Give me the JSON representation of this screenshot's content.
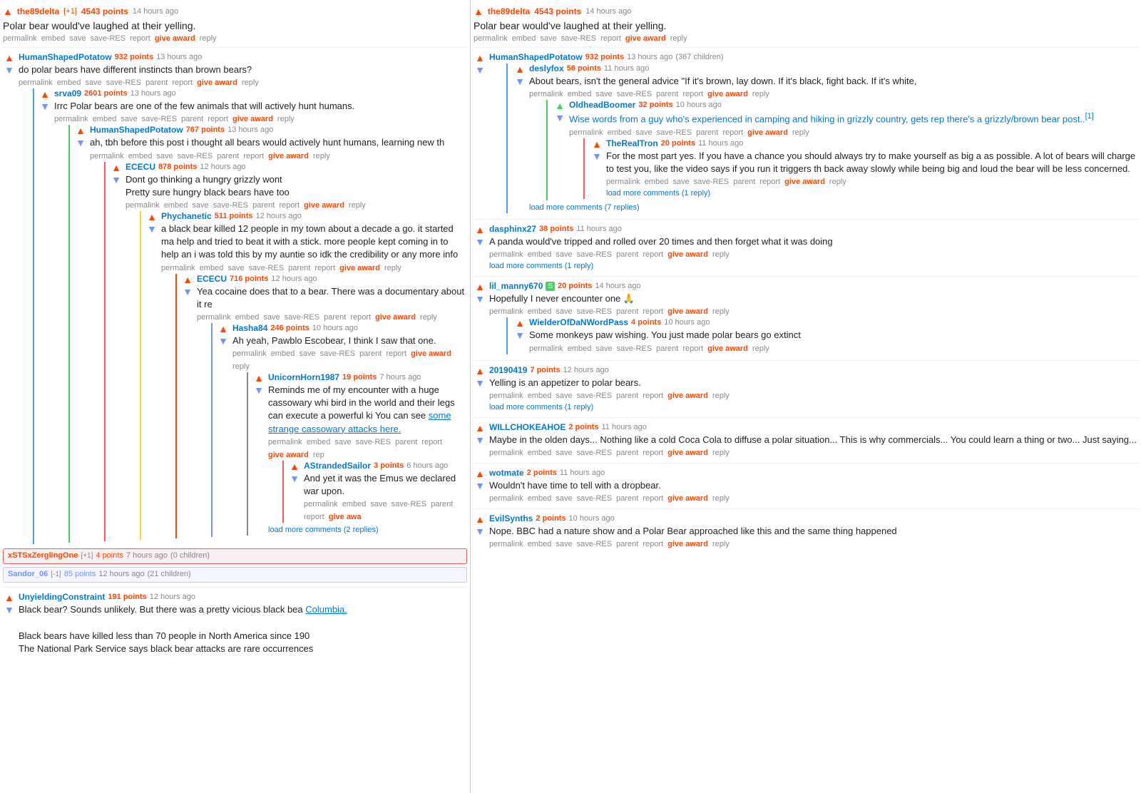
{
  "leftPanel": {
    "topComment": {
      "username": "the89delta",
      "points": "4543 points",
      "timestamp": "14 hours ago",
      "awards": "[+1]",
      "body": "Polar bear would've laughed at their yelling.",
      "actions": [
        "permalink",
        "embed",
        "save",
        "save-RES",
        "report",
        "give award",
        "reply"
      ]
    },
    "comments": [
      {
        "id": "c1",
        "username": "HumanShapedPotatow",
        "points": "932 points",
        "timestamp": "13 hours ago",
        "body": "do polar bears have different instincts than brown bears?",
        "actions": [
          "permalink",
          "embed",
          "save",
          "save-RES",
          "parent",
          "report",
          "give award",
          "reply"
        ],
        "indent": 0,
        "children": [
          {
            "id": "c1-1",
            "username": "srva09",
            "points": "2601 points",
            "timestamp": "13 hours ago",
            "body": "Irrc Polar bears are one of the few animals that will actively hunt humans.",
            "actions": [
              "permalink",
              "embed",
              "save",
              "save-RES",
              "parent",
              "report",
              "give award",
              "reply"
            ],
            "indent": 1,
            "children": [
              {
                "id": "c1-1-1",
                "username": "HumanShapedPotatow",
                "points": "767 points",
                "timestamp": "13 hours ago",
                "body": "ah, tbh before this post i thought all bears would actively hunt humans, learning new th",
                "actions": [
                  "permalink",
                  "embed",
                  "save",
                  "save-RES",
                  "parent",
                  "report",
                  "give award",
                  "reply"
                ],
                "indent": 2,
                "children": [
                  {
                    "id": "c1-1-1-1",
                    "username": "ECECU",
                    "points": "878 points",
                    "timestamp": "12 hours ago",
                    "body": "Dont go thinking a hungry grizzly wont\nPretty sure hungry black bears have too",
                    "actions": [
                      "permalink",
                      "embed",
                      "save",
                      "save-RES",
                      "parent",
                      "report",
                      "give award",
                      "reply"
                    ],
                    "indent": 3,
                    "children": [
                      {
                        "id": "c1-1-1-1-1",
                        "username": "Phychanetic",
                        "points": "511 points",
                        "timestamp": "12 hours ago",
                        "body": "a black bear killed 12 people in my town about a decade a go. it started ma help and tried to beat it with a stick. more people kept coming in to help an i was told this by my auntie so idk the credibility or any more info",
                        "actions": [
                          "permalink",
                          "embed",
                          "save",
                          "save-RES",
                          "parent",
                          "report",
                          "give award",
                          "reply"
                        ],
                        "indent": 4,
                        "children": [
                          {
                            "id": "c1-1-1-1-1-1",
                            "username": "ECECU",
                            "points": "716 points",
                            "timestamp": "12 hours ago",
                            "body": "Yea cocaine does that to a bear. There was a documentary about it re",
                            "actions": [
                              "permalink",
                              "embed",
                              "save",
                              "save-RES",
                              "parent",
                              "report",
                              "give award",
                              "reply"
                            ],
                            "indent": 5,
                            "children": [
                              {
                                "id": "c1-1-1-1-1-1-1",
                                "username": "Hasha84",
                                "points": "246 points",
                                "timestamp": "10 hours ago",
                                "body": "Ah yeah, Pawblo Escobear, I think I saw that one.",
                                "actions": [
                                  "permalink",
                                  "embed",
                                  "save",
                                  "save-RES",
                                  "parent",
                                  "report",
                                  "give award",
                                  "reply"
                                ],
                                "indent": 6,
                                "children": [
                                  {
                                    "id": "c1-1-1-1-1-1-1-1",
                                    "username": "UnicornHorn1987",
                                    "points": "19 points",
                                    "timestamp": "7 hours ago",
                                    "body": "Reminds me of my encounter with a huge cassowary whi bird in the world and their legs can execute a powerful ki You can see some strange cassowary attacks here.",
                                    "bodyLink": "some strange cassowary attacks here.",
                                    "actions": [
                                      "permalink",
                                      "embed",
                                      "save",
                                      "save-RES",
                                      "parent",
                                      "report",
                                      "give award",
                                      "rep"
                                    ],
                                    "indent": 7,
                                    "children": [
                                      {
                                        "id": "nested-1",
                                        "username": "AStrandedSailor",
                                        "points": "3 points",
                                        "timestamp": "6 hours ago",
                                        "body": "And yet it was the Emus we declared war upon.",
                                        "actions": [
                                          "permalink",
                                          "embed",
                                          "save",
                                          "save-RES",
                                          "parent",
                                          "report",
                                          "give awa"
                                        ],
                                        "indent": 8
                                      }
                                    ],
                                    "loadMore": "load more comments (2 replies)"
                                  }
                                ]
                              }
                            ]
                          }
                        ]
                      }
                    ]
                  }
                ]
              }
            ]
          }
        ]
      },
      {
        "id": "c-collapsed",
        "username": "xSTSxZerglingOne",
        "awards": "[+1]",
        "points": "4 points",
        "timestamp": "7 hours ago",
        "childCount": "(0 children)",
        "collapsed": true
      },
      {
        "id": "c-sandor",
        "username": "Sandor_06",
        "awards": "[-1]",
        "points": "85 points",
        "timestamp": "12 hours ago",
        "childCount": "(21 children)",
        "collapsed": true
      },
      {
        "id": "c-unyielding",
        "username": "UnyieldingConstraint",
        "points": "191 points",
        "timestamp": "12 hours ago",
        "body": "Black bear? Sounds unlikely. But there was a pretty vicious black bea Columbia.\n\nBlack bears have killed less than 70 people in North America since 190\nThe National Park Service says black bear attacks are rare occurrences",
        "actions": [
          "permalink",
          "embed",
          "save",
          "save-RES",
          "parent",
          "report",
          "give award",
          "reply"
        ],
        "indent": 0
      }
    ]
  },
  "rightPanel": {
    "topComment": {
      "username": "the89delta",
      "points": "4543 points",
      "timestamp": "14 hours ago",
      "body": "Polar bear would've laughed at their yelling.",
      "actions": [
        "permalink",
        "embed",
        "save",
        "save-RES",
        "report",
        "give award",
        "reply"
      ]
    },
    "comments": [
      {
        "id": "r1",
        "username": "HumanShapedPotatow",
        "points": "932 points",
        "timestamp": "13 hours ago",
        "childrenCount": "(367 children)",
        "indent": 0,
        "children": [
          {
            "id": "r1-1",
            "username": "deslyfox",
            "points": "56 points",
            "timestamp": "11 hours ago",
            "body": "About bears, isn't the general advice \"If it's brown, lay down. If it's black, fight back. If it's white,",
            "actions": [
              "permalink",
              "embed",
              "save",
              "save-RES",
              "parent",
              "report",
              "give award",
              "reply"
            ],
            "indent": 1,
            "children": [
              {
                "id": "r1-1-1",
                "username": "OldheadBoomer",
                "points": "32 points",
                "timestamp": "10 hours ago",
                "body": "Wise words from a guy who's experienced in camping and hiking in grizzly country, gets rep there's a grizzly/brown bear post..[1]",
                "bodyHighlight": true,
                "actions": [
                  "permalink",
                  "embed",
                  "save",
                  "save-RES",
                  "parent",
                  "report",
                  "give award",
                  "reply"
                ],
                "indent": 2,
                "children": [
                  {
                    "id": "r1-1-1-1",
                    "username": "TheRealTron",
                    "points": "20 points",
                    "timestamp": "11 hours ago",
                    "body": "For the most part yes. If you have a chance you should always try to make yourself as big a as possible. A lot of bears will charge to test you, like the video says if you run it triggers th back away slowly while being big and loud the bear will be less concerned.",
                    "actions": [
                      "permalink",
                      "embed",
                      "save",
                      "save-RES",
                      "parent",
                      "report",
                      "give award",
                      "reply"
                    ],
                    "indent": 3,
                    "loadMore": "load more comments (1 reply)"
                  }
                ]
              }
            ],
            "loadMore": "load more comments (7 replies)"
          }
        ]
      },
      {
        "id": "r2",
        "username": "dasphinx27",
        "points": "38 points",
        "timestamp": "11 hours ago",
        "body": "A panda would've tripped and rolled over 20 times and then forget what it was doing",
        "actions": [
          "permalink",
          "embed",
          "save",
          "save-RES",
          "parent",
          "report",
          "give award",
          "reply"
        ],
        "loadMore": "load more comments (1 reply)"
      },
      {
        "id": "r3",
        "username": "lil_manny670",
        "tag": "S",
        "points": "20 points",
        "timestamp": "14 hours ago",
        "body": "Hopefully I never encounter one 🙏",
        "actions": [
          "permalink",
          "embed",
          "save",
          "save-RES",
          "parent",
          "report",
          "give award",
          "reply"
        ],
        "children": [
          {
            "id": "r3-1",
            "username": "WielderOfDaNWordPass",
            "points": "4 points",
            "timestamp": "10 hours ago",
            "body": "Some monkeys paw wishing. You just made polar bears go extinct",
            "actions": [
              "permalink",
              "embed",
              "save",
              "save-RES",
              "parent",
              "report",
              "give award",
              "reply"
            ],
            "indent": 1
          }
        ]
      },
      {
        "id": "r4",
        "username": "20190419",
        "points": "7 points",
        "timestamp": "12 hours ago",
        "body": "Yelling is an appetizer to polar bears.",
        "actions": [
          "permalink",
          "embed",
          "save",
          "save-RES",
          "parent",
          "report",
          "give award",
          "reply"
        ],
        "loadMore": "load more comments (1 reply)"
      },
      {
        "id": "r5",
        "username": "WILLCHOKEAHOE",
        "points": "2 points",
        "timestamp": "11 hours ago",
        "body": "Maybe in the olden days... Nothing like a cold Coca Cola to diffuse a polar situation... This is why commercials... You could learn a thing or two... Just saying...",
        "actions": [
          "permalink",
          "embed",
          "save",
          "save-RES",
          "parent",
          "report",
          "give award",
          "reply"
        ]
      },
      {
        "id": "r6",
        "username": "wotmate",
        "points": "2 points",
        "timestamp": "11 hours ago",
        "body": "Wouldn't have time to tell with a dropbear.",
        "actions": [
          "permalink",
          "embed",
          "save",
          "save-RES",
          "parent",
          "report",
          "give award",
          "reply"
        ]
      },
      {
        "id": "r7",
        "username": "EvilSynths",
        "points": "2 points",
        "timestamp": "10 hours ago",
        "body": "Nope. BBC had a nature show and a Polar Bear approached like this and the same thing happened",
        "actions": [
          "permalink",
          "embed",
          "save",
          "save-RES",
          "parent",
          "report",
          "give award",
          "reply"
        ]
      }
    ]
  },
  "actions": {
    "permalink": "permalink",
    "embed": "embed",
    "save": "save",
    "saveRES": "save-RES",
    "parent": "parent",
    "report": "report",
    "giveAward": "give award",
    "reply": "reply"
  }
}
